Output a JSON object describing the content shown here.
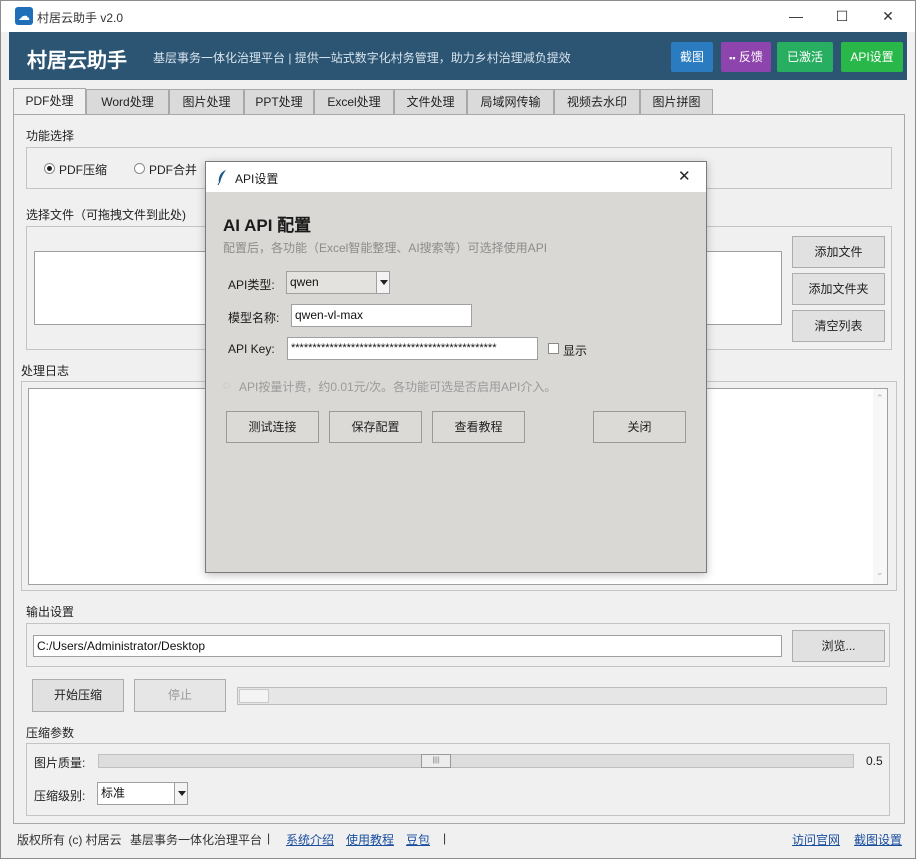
{
  "window": {
    "title": "村居云助手 v2.0",
    "min_glyph": "—",
    "max_glyph": "☐",
    "close_glyph": "✕"
  },
  "header": {
    "brand": "村居云助手",
    "slogan": "基层事务一体化治理平台 | 提供一站式数字化村务管理，助力乡村治理减负提效",
    "buttons": {
      "screenshot": "截图",
      "feedback": "反馈",
      "activated": "已激活",
      "api_settings": "API设置"
    },
    "colors": {
      "header_bg": "#2c5573",
      "screenshot": "#2a7bbf",
      "feedback": "#8e44ad",
      "activated": "#27ae60",
      "api_settings": "#2ab74a"
    }
  },
  "tabs": [
    "PDF处理",
    "Word处理",
    "图片处理",
    "PPT处理",
    "Excel处理",
    "文件处理",
    "局域网传输",
    "视频去水印",
    "图片拼图"
  ],
  "pdf": {
    "function_label": "功能选择",
    "radio_compress": "PDF压缩",
    "radio_merge": "PDF合并",
    "file_label": "选择文件（可拖拽文件到此处)",
    "add_file": "添加文件",
    "add_folder": "添加文件夹",
    "clear_list": "清空列表",
    "log_label": "处理日志",
    "output_label": "输出设置",
    "output_path": "C:/Users/Administrator/Desktop",
    "browse": "浏览...",
    "start": "开始压缩",
    "stop": "停止",
    "progress": 0,
    "params_label": "压缩参数",
    "quality_label": "图片质量:",
    "quality_value": "0.5",
    "level_label": "压缩级别:",
    "level_value": "标准"
  },
  "footer": {
    "copyright": "版权所有 (c) 村居云",
    "platform": "基层事务一体化治理平台",
    "sep": "|",
    "link_intro": "系统介绍",
    "link_tutorial": "使用教程",
    "link_doubao": "豆包",
    "link_website": "访问官网",
    "link_screenshot_settings": "截图设置"
  },
  "dialog": {
    "title": "API设置",
    "close_glyph": "✕",
    "heading": "AI API 配置",
    "description": "配置后，各功能（Excel智能整理、AI搜索等）可选择使用API",
    "api_type_label": "API类型:",
    "api_type_value": "qwen",
    "model_label": "模型名称:",
    "model_value": "qwen-vl-max",
    "key_label": "API Key:",
    "key_value": "************************************************",
    "show_label": "显示",
    "hint": "API按量计费，约0.01元/次。各功能可选是否启用API介入。",
    "test": "测试连接",
    "save": "保存配置",
    "tutorial": "查看教程",
    "close": "关闭"
  }
}
